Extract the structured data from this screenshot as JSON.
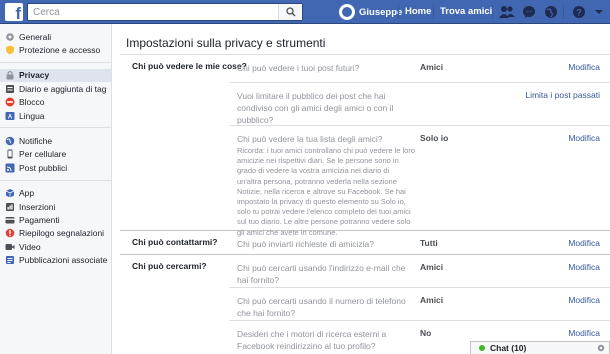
{
  "topbar": {
    "logo": "f",
    "search_placeholder": "Cerca",
    "user_name": "Giuseppe",
    "home_label": "Home",
    "find_friends_label": "Trova amici"
  },
  "sidebar": {
    "groups": [
      [
        {
          "label": "Generali",
          "icon": "gear-icon"
        },
        {
          "label": "Protezione e accesso",
          "icon": "shield-icon"
        }
      ],
      [
        {
          "label": "Privacy",
          "icon": "lock-icon",
          "active": true
        },
        {
          "label": "Diario e aggiunta di tag",
          "icon": "timeline-icon"
        },
        {
          "label": "Blocco",
          "icon": "block-icon"
        },
        {
          "label": "Lingua",
          "icon": "language-icon"
        }
      ],
      [
        {
          "label": "Notifiche",
          "icon": "globe-icon"
        },
        {
          "label": "Per cellulare",
          "icon": "mobile-icon"
        },
        {
          "label": "Post pubblici",
          "icon": "rss-icon"
        }
      ],
      [
        {
          "label": "App",
          "icon": "apps-icon"
        },
        {
          "label": "Inserzioni",
          "icon": "ads-icon"
        },
        {
          "label": "Pagamenti",
          "icon": "payments-icon"
        },
        {
          "label": "Riepilogo segnalazioni",
          "icon": "report-icon"
        },
        {
          "label": "Video",
          "icon": "video-icon"
        },
        {
          "label": "Pubblicazioni associate",
          "icon": "posts-icon"
        }
      ]
    ]
  },
  "main": {
    "title": "Impostazioni sulla privacy e strumenti",
    "sections": [
      {
        "label": "Chi può vedere le mie cose?",
        "rows": [
          {
            "question": "Chi può vedere i tuoi post futuri?",
            "value": "Amici",
            "action": "Modifica"
          },
          {
            "question": "Vuoi limitare il pubblico dei post che hai condiviso con gli amici degli amici o con il pubblico?",
            "value": "",
            "action": "Limita i post passati"
          },
          {
            "question": "Chi può vedere la tua lista degli amici?",
            "value": "Solo io",
            "action": "Modifica",
            "note": "Ricorda: i tuoi amici controllano chi può vedere le loro amicizie nei rispettivi diari. Se le persone sono in grado di vedere la vostra amicizia nel diario di un'altra persona, potranno vederla nella sezione Notizie, nella ricerca e altrove su Facebook. Se hai impostato la privacy di questo elemento su Solo io, solo tu potrai vedere l'elenco completo dei tuoi amici sul tuo diario. Le altre persone potranno vedere solo gli amici che avete in comune."
          }
        ]
      },
      {
        "label": "Chi può contattarmi?",
        "rows": [
          {
            "question": "Chi può inviarti richieste di amicizia?",
            "value": "Tutti",
            "action": "Modifica"
          }
        ]
      },
      {
        "label": "Chi può cercarmi?",
        "rows": [
          {
            "question": "Chi può cercarti usando l'indirizzo e-mail che hai fornito?",
            "value": "Amici",
            "action": "Modifica"
          },
          {
            "question": "Chi può cercarti usando il numero di telefono che hai fornito?",
            "value": "Amici",
            "action": "Modifica"
          },
          {
            "question": "Desideri che i motori di ricerca esterni a Facebook reindirizzino al tuo profilo?",
            "value": "No",
            "action": "Modifica"
          }
        ]
      }
    ]
  },
  "chat": {
    "label": "Chat (10)"
  },
  "colors": {
    "brand": "#4267b2",
    "link": "#365899",
    "online": "#42b72a"
  }
}
